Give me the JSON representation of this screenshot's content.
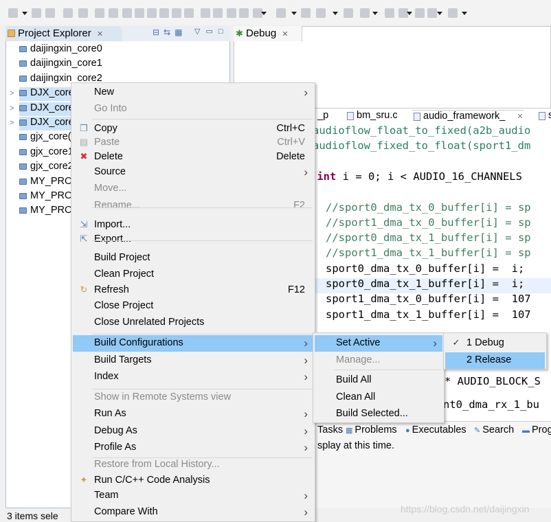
{
  "project_explorer": {
    "title": "Project Explorer",
    "items": [
      {
        "label": "daijingxin_core0",
        "selected": false,
        "expandable": false
      },
      {
        "label": "daijingxin_core1",
        "selected": false,
        "expandable": false
      },
      {
        "label": "daijingxin_core2",
        "selected": false,
        "expandable": false
      },
      {
        "label": "DJX_core",
        "selected": true,
        "expandable": true
      },
      {
        "label": "DJX_core",
        "selected": true,
        "expandable": true
      },
      {
        "label": "DJX_core",
        "selected": true,
        "expandable": true
      },
      {
        "label": "gjx_core(",
        "selected": false,
        "expandable": false
      },
      {
        "label": "gjx_core1",
        "selected": false,
        "expandable": false
      },
      {
        "label": "gjx_core2",
        "selected": false,
        "expandable": false
      },
      {
        "label": "MY_PRO",
        "selected": false,
        "expandable": false
      },
      {
        "label": "MY_PRO",
        "selected": false,
        "expandable": false
      },
      {
        "label": "MY_PRO",
        "selected": false,
        "expandable": false
      }
    ]
  },
  "debug": {
    "title": "Debug"
  },
  "editor": {
    "tabs": [
      {
        "label": "_p"
      },
      {
        "label": "bm_sru.c"
      },
      {
        "label": "audio_framework_",
        "active": true
      },
      {
        "label": "s"
      }
    ],
    "lines": [
      {
        "text": "audioflow_float_to_fixed(a2b_audio",
        "cls": "green",
        "indent": 0
      },
      {
        "text": "audioflow_fixed_to_float(sport1_dm",
        "cls": "green",
        "indent": 0
      },
      {
        "text": "",
        "cls": "",
        "indent": 0
      },
      {
        "text": "(int i = 0; i < AUDIO_16_CHANNELS",
        "cls": "for",
        "indent": 0
      },
      {
        "text": "",
        "cls": "",
        "indent": 0
      },
      {
        "text": "//sport0_dma_tx_0_buffer[i] = sp",
        "cls": "cm",
        "indent": 1
      },
      {
        "text": "//sport1_dma_tx_0_buffer[i] = sp",
        "cls": "cm",
        "indent": 1
      },
      {
        "text": "//sport0_dma_tx_1_buffer[i] = sp",
        "cls": "cm",
        "indent": 1
      },
      {
        "text": "//sport1_dma_tx_1_buffer[i] = sp",
        "cls": "cm",
        "indent": 1
      },
      {
        "text": "sport0_dma_tx_0_buffer[i] =  i;",
        "cls": "",
        "indent": 1
      },
      {
        "text": "sport0_dma_tx_1_buffer[i] =  i;",
        "cls": "",
        "indent": 1,
        "current": true
      },
      {
        "text": "sport1_dma_tx_0_buffer[i] =  107",
        "cls": "",
        "indent": 1
      },
      {
        "text": "sport1_dma_tx_1_buffer[i] =  107",
        "cls": "",
        "indent": 1
      }
    ],
    "hidden_lines": [
      "* AUDIO_BLOCK_S",
      "nt0_dma_rx_1_bu"
    ]
  },
  "bottom": {
    "tabs": [
      "Tasks",
      "Problems",
      "Executables",
      "Search",
      "Prog"
    ],
    "message": "splay at this time."
  },
  "status": {
    "text": "3 items sele"
  },
  "watermark": "https://blog.csdn.net/daijingxin",
  "context_menu": [
    {
      "label": "New",
      "submenu": true
    },
    {
      "label": "Go Into",
      "disabled": true
    },
    {
      "sep": true
    },
    {
      "label": "Copy",
      "shortcut": "Ctrl+C",
      "icon": "copy-icon"
    },
    {
      "label": "Paste",
      "shortcut": "Ctrl+V",
      "disabled": true,
      "icon": "paste-icon"
    },
    {
      "label": "Delete",
      "shortcut": "Delete",
      "icon": "delete-icon"
    },
    {
      "label": "Source",
      "submenu": true
    },
    {
      "label": "Move...",
      "disabled": true
    },
    {
      "label": "Rename...",
      "shortcut": "F2",
      "disabled": true
    },
    {
      "sep": true
    },
    {
      "label": "Import...",
      "icon": "import-icon"
    },
    {
      "label": "Export...",
      "icon": "export-icon"
    },
    {
      "sep": true
    },
    {
      "label": "Build Project"
    },
    {
      "label": "Clean Project"
    },
    {
      "label": "Refresh",
      "shortcut": "F12",
      "icon": "refresh-icon"
    },
    {
      "label": "Close Project"
    },
    {
      "label": "Close Unrelated Projects"
    },
    {
      "sep": true
    },
    {
      "label": "Build Configurations",
      "submenu": true,
      "highlighted": true
    },
    {
      "label": "Build Targets",
      "submenu": true
    },
    {
      "label": "Index",
      "submenu": true
    },
    {
      "sep": true
    },
    {
      "label": "Show in Remote Systems view",
      "disabled": true
    },
    {
      "label": "Run As",
      "submenu": true
    },
    {
      "label": "Debug As",
      "submenu": true
    },
    {
      "label": "Profile As",
      "submenu": true
    },
    {
      "sep": true
    },
    {
      "label": "Restore from Local History...",
      "disabled": true
    },
    {
      "label": "Run C/C++ Code Analysis",
      "icon": "code-analysis-icon"
    },
    {
      "label": "Team",
      "submenu": true
    },
    {
      "label": "Compare With",
      "submenu": true
    }
  ],
  "build_config_menu": [
    {
      "label": "Set Active",
      "submenu": true,
      "highlighted": true
    },
    {
      "label": "Manage...",
      "disabled": true
    },
    {
      "sep": true
    },
    {
      "label": "Build All"
    },
    {
      "label": "Clean All"
    },
    {
      "label": "Build Selected..."
    }
  ],
  "set_active_menu": [
    {
      "label": "1 Debug",
      "checked": true
    },
    {
      "label": "2 Release",
      "highlighted": true
    }
  ],
  "colors": {
    "highlight": "#91c9f7",
    "selection": "#cde3f7",
    "code_green": "#2a7f62",
    "keyword": "#7f0055"
  }
}
